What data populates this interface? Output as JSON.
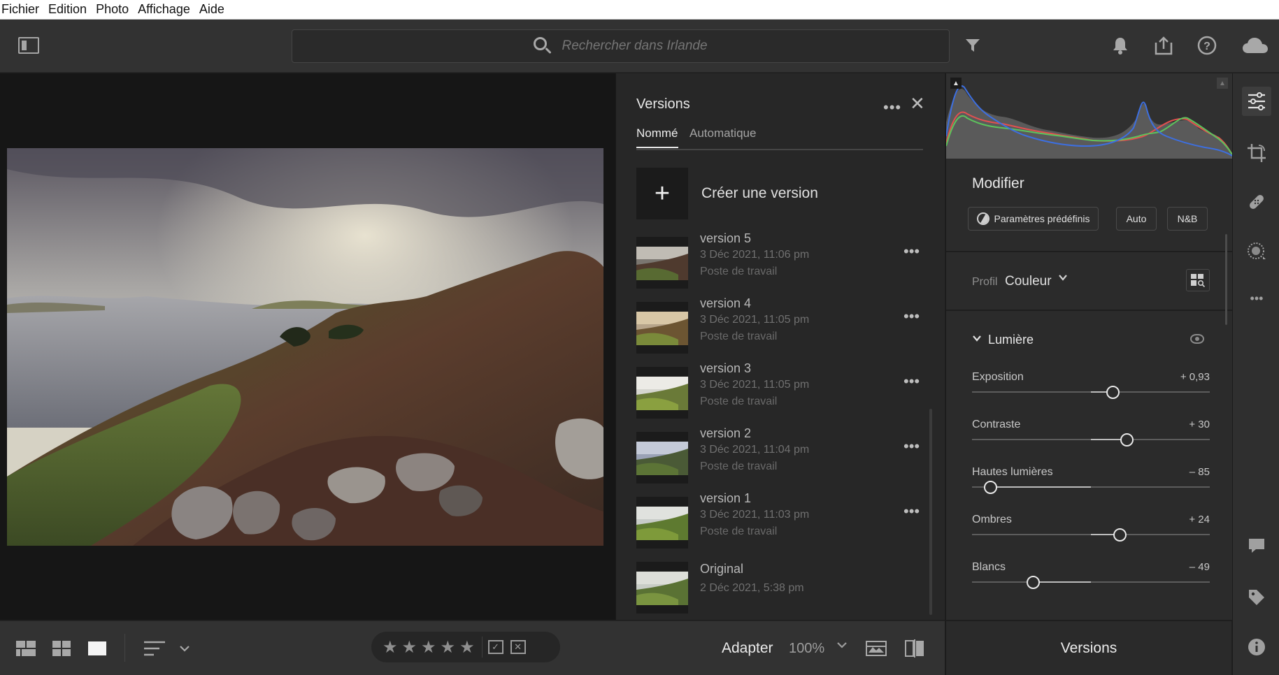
{
  "menu": [
    "Fichier",
    "Edition",
    "Photo",
    "Affichage",
    "Aide"
  ],
  "toolbar": {
    "search_placeholder": "Rechercher dans Irlande",
    "icons": [
      "sidebar-toggle-icon",
      "search-icon",
      "filter-icon",
      "bell-icon",
      "share-icon",
      "help-icon",
      "cloud-icon"
    ]
  },
  "versions_panel": {
    "title": "Versions",
    "tabs": [
      {
        "label": "Nommé",
        "active": true
      },
      {
        "label": "Automatique",
        "active": false
      }
    ],
    "create_label": "Créer une version",
    "versions": [
      {
        "name": "version 5",
        "date": "3 Déc 2021, 11:06 pm",
        "device": "Poste de travail"
      },
      {
        "name": "version 4",
        "date": "3 Déc 2021, 11:05 pm",
        "device": "Poste de travail"
      },
      {
        "name": "version 3",
        "date": "3 Déc 2021, 11:05 pm",
        "device": "Poste de travail"
      },
      {
        "name": "version 2",
        "date": "3 Déc 2021, 11:04 pm",
        "device": "Poste de travail"
      },
      {
        "name": "version 1",
        "date": "3 Déc 2021, 11:03 pm",
        "device": "Poste de travail"
      },
      {
        "name": "Original",
        "date": "2 Déc 2021, 5:38 pm",
        "device": ""
      }
    ]
  },
  "edit_panel": {
    "title": "Modifier",
    "presets_label": "Paramètres prédéfinis",
    "auto_label": "Auto",
    "bw_label": "N&B",
    "profile_label": "Profil",
    "profile_value": "Couleur",
    "section_title": "Lumière",
    "sliders": [
      {
        "label": "Exposition",
        "value": "+ 0,93",
        "level": 0.59
      },
      {
        "label": "Contraste",
        "value": "+ 30",
        "level": 0.65
      },
      {
        "label": "Hautes lumières",
        "value": "– 85",
        "level": 0.075
      },
      {
        "label": "Ombres",
        "value": "+ 24",
        "level": 0.62
      },
      {
        "label": "Blancs",
        "value": "– 49",
        "level": 0.255
      }
    ]
  },
  "bottom_bar": {
    "fit_label": "Adapter",
    "zoom_value": "100%",
    "rating": 0
  },
  "footer_label": "Versions",
  "colors": {
    "accent": "#e8e8e8",
    "panel": "#272727",
    "toolbar": "#323232"
  }
}
